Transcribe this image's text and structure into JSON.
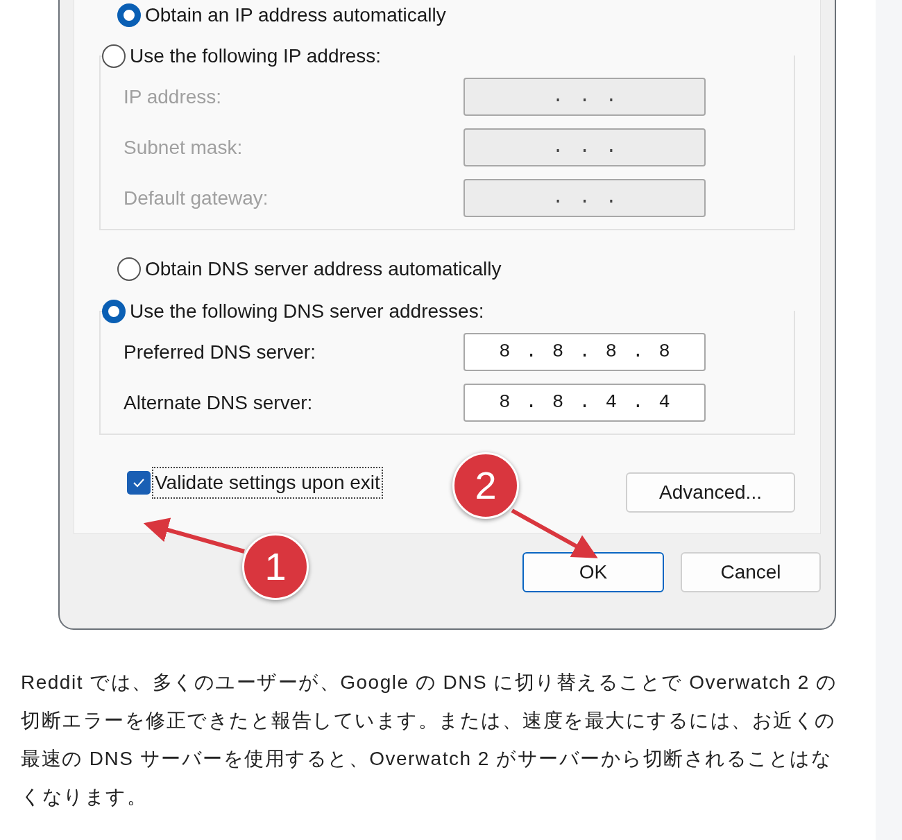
{
  "dialog": {
    "ip_options": [
      {
        "label": "Obtain an IP address automatically",
        "selected": true
      },
      {
        "label": "Use the following IP address:",
        "selected": false
      }
    ],
    "ip_fields": [
      {
        "label": "IP address:",
        "value": ". . .",
        "disabled": true
      },
      {
        "label": "Subnet mask:",
        "value": ". . .",
        "disabled": true
      },
      {
        "label": "Default gateway:",
        "value": ". . .",
        "disabled": true
      }
    ],
    "dns_options": [
      {
        "label": "Obtain DNS server address automatically",
        "selected": false
      },
      {
        "label": "Use the following DNS server addresses:",
        "selected": true
      }
    ],
    "dns_fields": [
      {
        "label": "Preferred DNS server:",
        "value": "8 . 8 . 8 . 8",
        "disabled": false
      },
      {
        "label": "Alternate DNS server:",
        "value": "8 . 8 . 4 . 4",
        "disabled": false
      }
    ],
    "validate": {
      "label": "Validate settings upon exit",
      "checked": true
    },
    "advanced_button": "Advanced...",
    "buttons": [
      {
        "label": "OK",
        "default": true
      },
      {
        "label": "Cancel",
        "default": false
      }
    ]
  },
  "annotations": [
    {
      "label": "1"
    },
    {
      "label": "2"
    }
  ],
  "paragraph": "Reddit では、多くのユーザーが、Google の DNS に切り替えることで Overwatch 2 の切断エラーを修正できたと報告しています。または、速度を最大にするには、お近くの最速の DNS サーバーを使用すると、Overwatch 2 がサーバーから切断されることはなくなります。"
}
